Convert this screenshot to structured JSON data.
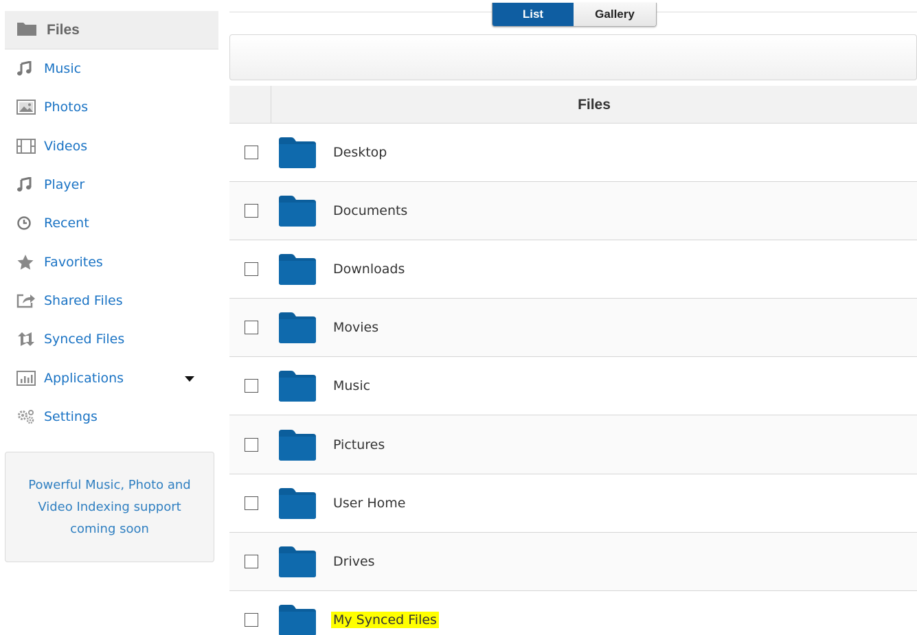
{
  "sidebar": {
    "active": {
      "label": "Files",
      "icon": "folder-icon"
    },
    "items": [
      {
        "label": "Music",
        "icon": "music-note-icon"
      },
      {
        "label": "Photos",
        "icon": "photo-icon"
      },
      {
        "label": "Videos",
        "icon": "film-icon"
      },
      {
        "label": "Player",
        "icon": "music-note-icon"
      },
      {
        "label": "Recent",
        "icon": "clock-icon"
      },
      {
        "label": "Favorites",
        "icon": "star-icon"
      },
      {
        "label": "Shared Files",
        "icon": "share-icon"
      },
      {
        "label": "Synced Files",
        "icon": "sync-icon"
      },
      {
        "label": "Applications",
        "icon": "chart-icon"
      },
      {
        "label": "Settings",
        "icon": "gears-icon"
      }
    ],
    "promo": "Powerful Music, Photo and Video Indexing support coming soon"
  },
  "view_toggle": {
    "list": "List",
    "gallery": "Gallery",
    "selected": "List"
  },
  "table": {
    "header": "Files",
    "rows": [
      {
        "name": "Desktop"
      },
      {
        "name": "Documents"
      },
      {
        "name": "Downloads"
      },
      {
        "name": "Movies"
      },
      {
        "name": "Music"
      },
      {
        "name": "Pictures"
      },
      {
        "name": "User Home"
      },
      {
        "name": "Drives"
      },
      {
        "name": "My Synced Files",
        "highlighted": true
      }
    ]
  },
  "colors": {
    "accent": "#0f5ea2",
    "link": "#1a73c4",
    "folder": "#0b5e9c",
    "highlight": "#ffff00"
  }
}
